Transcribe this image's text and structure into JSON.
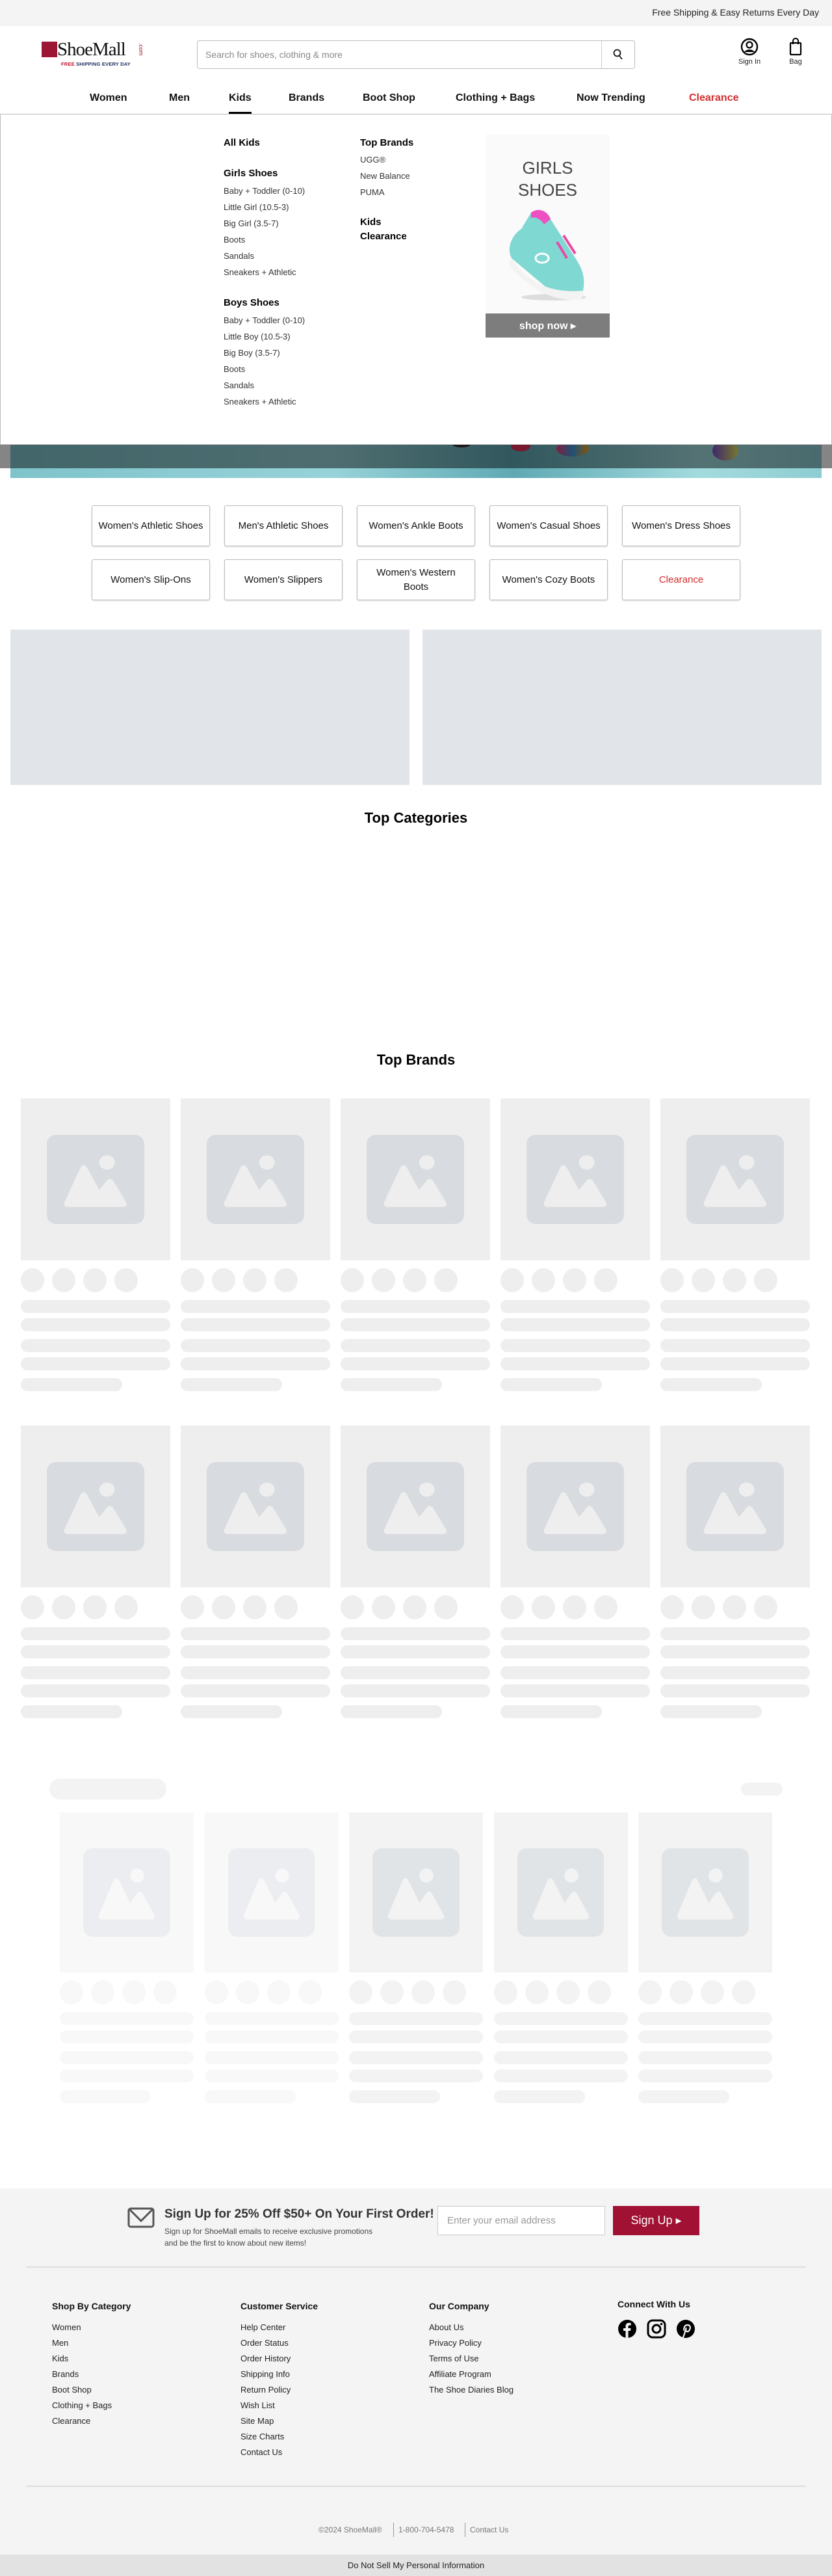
{
  "topbar": {
    "message": "Free Shipping & Easy Returns Every Day"
  },
  "logo": {
    "name": "ShoeMall",
    "suffix": ".com",
    "tagline_free": "FREE",
    "tagline_rest": "SHIPPING EVERY DAY",
    "brand_color": "#9c1733"
  },
  "search": {
    "placeholder": "Search for shoes, clothing & more",
    "value": "",
    "icon": "search-icon"
  },
  "account": {
    "sign_in": "Sign In",
    "bag": "Bag"
  },
  "nav": {
    "items": [
      {
        "label": "Women"
      },
      {
        "label": "Men"
      },
      {
        "label": "Kids",
        "active": true
      },
      {
        "label": "Brands"
      },
      {
        "label": "Boot Shop"
      },
      {
        "label": "Clothing + Bags"
      },
      {
        "label": "Now Trending"
      },
      {
        "label": "Clearance",
        "color": "#d32f2f"
      }
    ]
  },
  "mega_menu": {
    "all": "All Kids",
    "girls": {
      "title": "Girls Shoes",
      "items": [
        "Baby + Toddler (0-10)",
        "Little Girl (10.5-3)",
        "Big Girl (3.5-7)",
        "Boots",
        "Sandals",
        "Sneakers + Athletic"
      ]
    },
    "boys": {
      "title": "Boys Shoes",
      "items": [
        "Baby + Toddler (0-10)",
        "Little Boy (10.5-3)",
        "Big Boy (3.5-7)",
        "Boots",
        "Sandals",
        "Sneakers + Athletic"
      ]
    },
    "top_brands": {
      "title": "Top Brands",
      "items": [
        "UGG®",
        "New Balance",
        "PUMA"
      ]
    },
    "clearance": {
      "line1": "Kids",
      "line2": "Clearance"
    },
    "promo": {
      "line1": "GIRLS",
      "line2": "SHOES",
      "cta": "shop now ▸"
    }
  },
  "categories": [
    "Women's Athletic Shoes",
    "Men's Athletic Shoes",
    "Women's Ankle Boots",
    "Women's Casual Shoes",
    "Women's Dress Shoes",
    "Women's Slip-Ons",
    "Women's Slippers",
    "Women's Western Boots",
    "Women's Cozy Boots",
    "Clearance"
  ],
  "sections": {
    "top_categories": "Top Categories",
    "top_brands": "Top Brands"
  },
  "newsletter": {
    "title": "Sign Up for 25% Off $50+ On Your First Order!",
    "line1": "Sign up for ShoeMall emails to receive exclusive promotions",
    "line2": "and be the first to know about new items!",
    "email_placeholder": "Enter your email address",
    "button": "Sign Up ▸",
    "accent": "#a01133"
  },
  "footer": {
    "columns": [
      {
        "title": "Shop By Category",
        "items": [
          "Women",
          "Men",
          "Kids",
          "Brands",
          "Boot Shop",
          "Clothing + Bags",
          "Clearance"
        ]
      },
      {
        "title": "Customer Service",
        "items": [
          "Help Center",
          "Order Status",
          "Order History",
          "Shipping Info",
          "Return Policy",
          "Wish List",
          "Site Map",
          "Size Charts",
          "Contact Us"
        ]
      },
      {
        "title": "Our Company",
        "items": [
          "About Us",
          "Privacy Policy",
          "Terms of Use",
          "Affiliate Program",
          "The Shoe Diaries Blog"
        ]
      }
    ],
    "connect": {
      "title": "Connect With Us",
      "icons": [
        "facebook-icon",
        "instagram-icon",
        "pinterest-icon"
      ]
    },
    "copyright": "©2024 ShoeMall®",
    "phone": "1-800-704-5478",
    "contact": "Contact Us",
    "do_not_sell": "Do Not Sell My Personal Information"
  }
}
